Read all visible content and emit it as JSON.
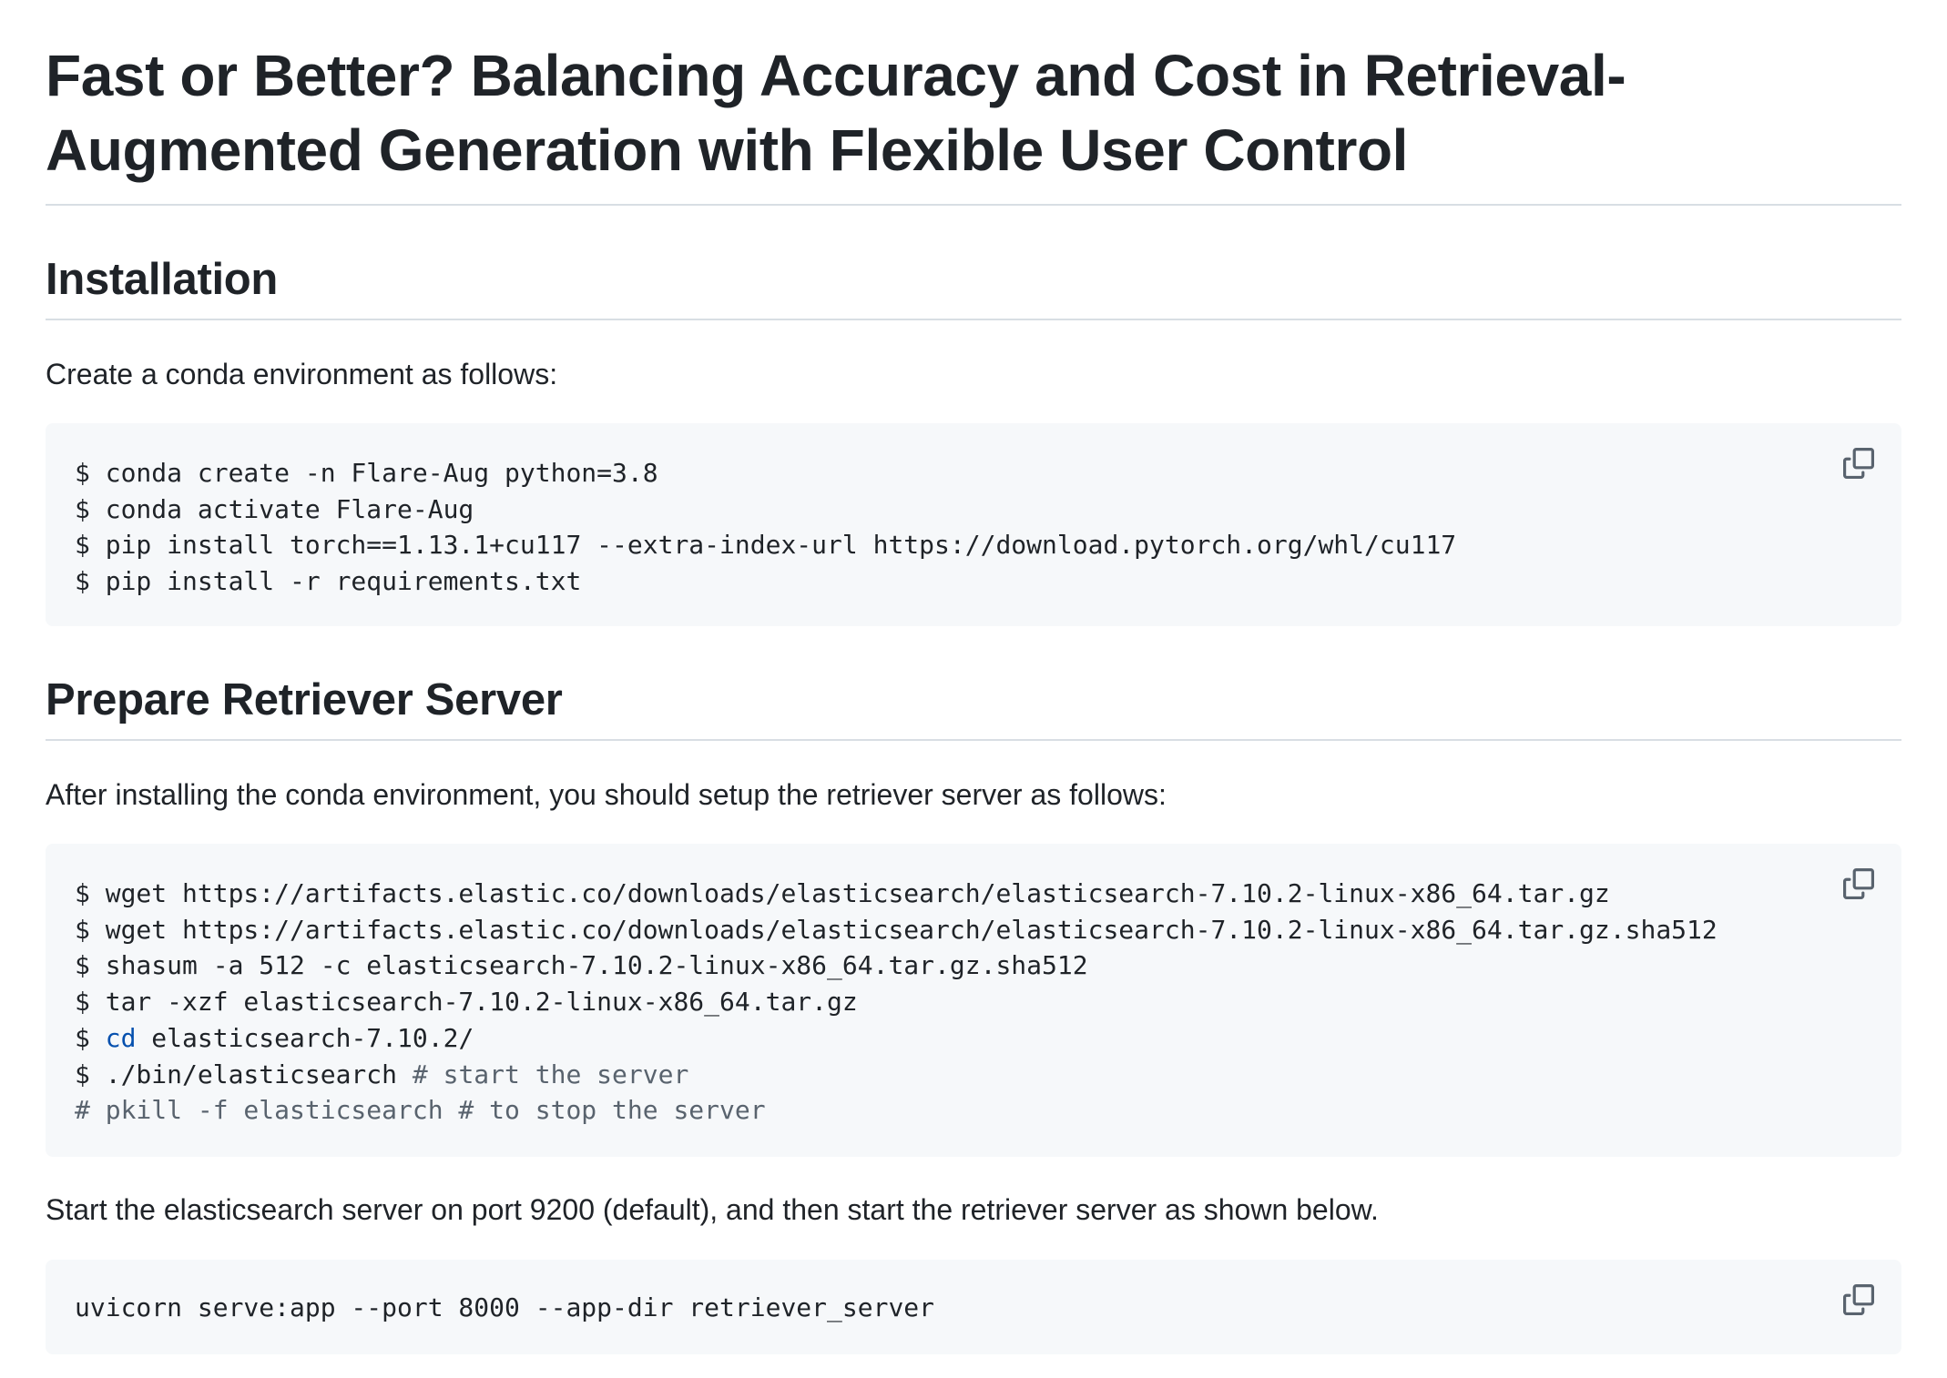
{
  "title": "Fast or Better? Balancing Accuracy and Cost in Retrieval-Augmented Generation with Flexible User Control",
  "sections": {
    "installation": {
      "heading": "Installation",
      "intro": "Create a conda environment as follows:",
      "code": {
        "lines": [
          "$ conda create -n Flare-Aug python=3.8",
          "$ conda activate Flare-Aug",
          "$ pip install torch==1.13.1+cu117 --extra-index-url https://download.pytorch.org/whl/cu117",
          "$ pip install -r requirements.txt"
        ]
      }
    },
    "retriever": {
      "heading": "Prepare Retriever Server",
      "intro": "After installing the conda environment, you should setup the retriever server as follows:",
      "code": {
        "lines": [
          "$ wget https://artifacts.elastic.co/downloads/elasticsearch/elasticsearch-7.10.2-linux-x86_64.tar.gz",
          "$ wget https://artifacts.elastic.co/downloads/elasticsearch/elasticsearch-7.10.2-linux-x86_64.tar.gz.sha512",
          "$ shasum -a 512 -c elasticsearch-7.10.2-linux-x86_64.tar.gz.sha512",
          "$ tar -xzf elasticsearch-7.10.2-linux-x86_64.tar.gz"
        ],
        "cd_prompt": "$ ",
        "cd_keyword": "cd",
        "cd_rest": " elasticsearch-7.10.2/",
        "run_cmd": "$ ./bin/elasticsearch ",
        "run_comment": "# start the server",
        "stop_comment": "# pkill -f elasticsearch # to stop the server"
      },
      "after_text": "Start the elasticsearch server on port 9200 (default), and then start the retriever server as shown below.",
      "serve_code": {
        "lines": [
          "uvicorn serve:app --port 8000 --app-dir retriever_server"
        ]
      }
    }
  },
  "icons": {
    "copy": "copy-icon"
  },
  "colors": {
    "text": "#1f2328",
    "code_background": "#f6f8fa",
    "keyword": "#0550ae",
    "comment": "#59636e",
    "rule": "#d8dee4"
  }
}
